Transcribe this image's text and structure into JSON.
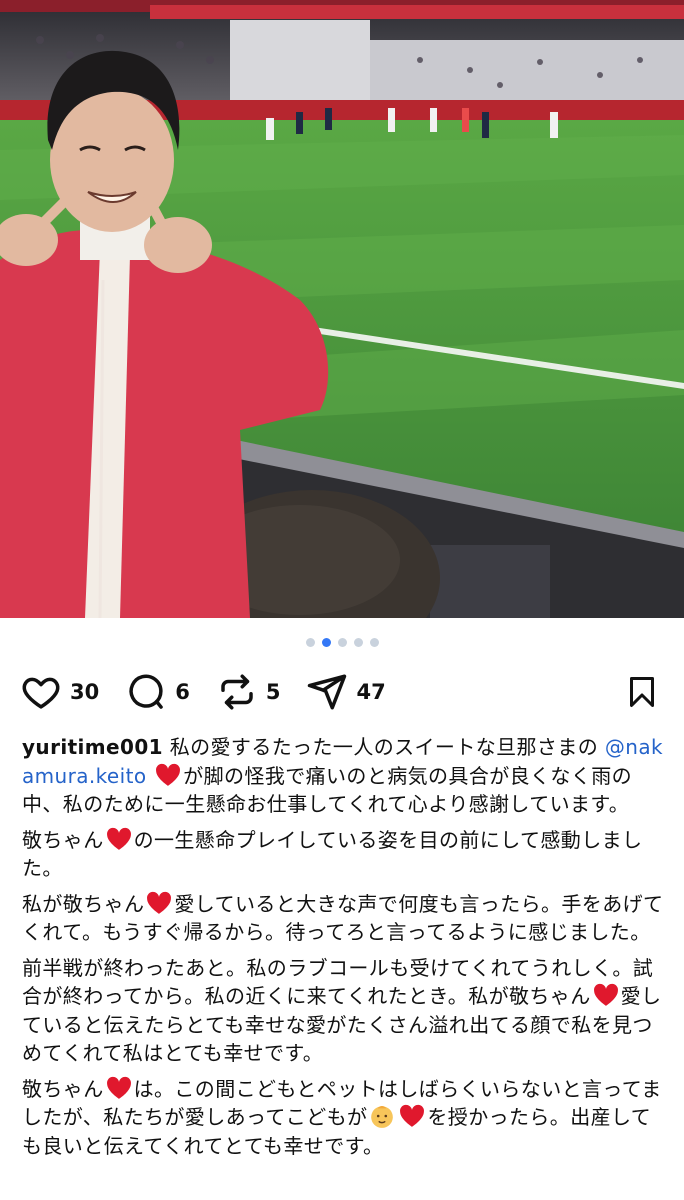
{
  "post": {
    "image": {
      "alt_icon": "photo-image",
      "carousel": {
        "count": 5,
        "active": 2
      }
    },
    "actions": {
      "likes": "30",
      "comments": "6",
      "reposts": "5",
      "shares": "47"
    },
    "caption": {
      "username": "yuritime001",
      "p1_text1": "私の愛するたった一人のスイートな旦那さまの",
      "mention": "@nakamura.keito",
      "p1_text2": "が脚の怪我で痛いのと病気の具合が良くなく雨の中、私のために一生懸命お仕事してくれて心より感謝しています。",
      "p2_text1": "敬ちゃん",
      "p2_text2": "の一生懸命プレイしている姿を目の前にして感動しました。",
      "p3_text1": "私が敬ちゃん",
      "p3_text2": "愛していると大きな声で何度も言ったら。手をあげてくれて。もうすぐ帰るから。待ってろと言ってるように感じました。",
      "p4_text1": "前半戦が終わったあと。私のラブコールも受けてくれてうれしく。試合が終わってから。私の近くに来てくれたとき。私が敬ちゃん",
      "p4_text2": "愛していると伝えたらとても幸せな愛がたくさん溢れ出てる顔で私を見つめてくれて私はとても幸せです。",
      "p5_text1": "敬ちゃん",
      "p5_text2": "は。この間こどもとペットはしばらくいらないと言ってましたが、私たちが愛しあってこどもが",
      "p5_text3": "を授かったら。出産しても良いと伝えてくれてとても幸せです。"
    },
    "colors": {
      "heart": "#e0182d",
      "mention": "#2563c9",
      "dot_active": "#3478f6",
      "jacket": "#d8394f",
      "pitch": "#4c9a3f"
    }
  }
}
